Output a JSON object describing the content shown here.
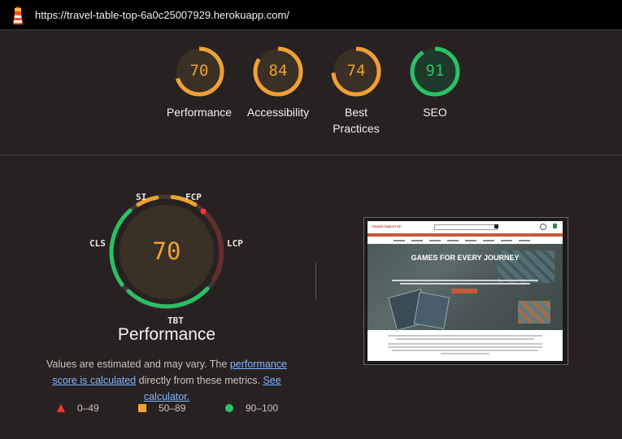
{
  "header": {
    "url": "https://travel-table-top-6a0c25007929.herokuapp.com/"
  },
  "colors": {
    "average": "#f0a035",
    "pass": "#2bc167",
    "fail": "#ff3333",
    "link": "#82b6ff"
  },
  "summary_gauges": [
    {
      "label": "Performance",
      "score": "70",
      "rating": "average"
    },
    {
      "label": "Accessibility",
      "score": "84",
      "rating": "average"
    },
    {
      "label": "Best Practices",
      "score": "74",
      "rating": "average"
    },
    {
      "label": "SEO",
      "score": "91",
      "rating": "pass"
    }
  ],
  "performance": {
    "score": "70",
    "title": "Performance",
    "metrics": {
      "si": "SI",
      "fcp": "FCP",
      "lcp": "LCP",
      "tbt": "TBT",
      "cls": "CLS"
    },
    "description": {
      "prefix": "Values are estimated and may vary. The ",
      "link1": "performance score is calculated",
      "middle": " directly from these metrics. ",
      "link2": "See calculator."
    }
  },
  "legend": [
    {
      "range": "0–49",
      "icon": "triangle-icon"
    },
    {
      "range": "50–89",
      "icon": "square-icon"
    },
    {
      "range": "90–100",
      "icon": "circle-icon"
    }
  ],
  "screenshot": {
    "site_logo": "TRAVELTABLETOP",
    "hero_title": "GAMES FOR EVERY JOURNEY"
  }
}
